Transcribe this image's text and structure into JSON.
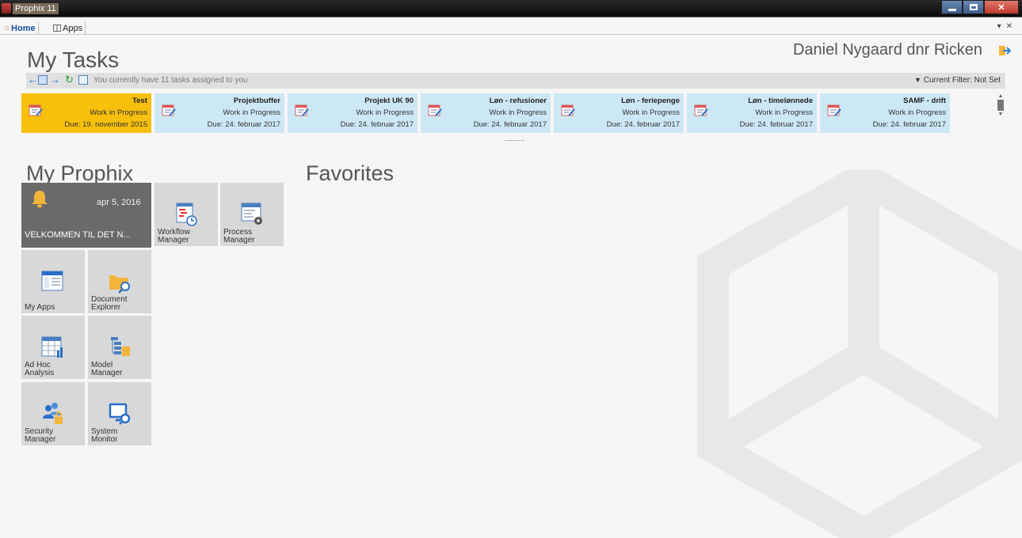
{
  "window": {
    "title": "Prophix 11"
  },
  "tabs": [
    {
      "label": "Home"
    },
    {
      "label": "Apps"
    }
  ],
  "header": {
    "title": "My Tasks",
    "user": "Daniel Nygaard dnr Ricken"
  },
  "tasks_toolbar": {
    "summary": "You currently have 11 tasks assigned to you",
    "filter": "Current Filter: Not Set"
  },
  "tasks": [
    {
      "name": "Test",
      "status": "Work in Progress",
      "due": "Due: 19. november 2015"
    },
    {
      "name": "Projektbuffer",
      "status": "Work in Progress",
      "due": "Due: 24. februar 2017"
    },
    {
      "name": "Projekt UK 90",
      "status": "Work in Progress",
      "due": "Due: 24. februar 2017"
    },
    {
      "name": "Løn - refusioner",
      "status": "Work in Progress",
      "due": "Due: 24. februar 2017"
    },
    {
      "name": "Løn - feriepenge",
      "status": "Work in Progress",
      "due": "Due: 24. februar 2017"
    },
    {
      "name": "Løn - timelønnede",
      "status": "Work in Progress",
      "due": "Due: 24. februar 2017"
    },
    {
      "name": "SAMF - drift",
      "status": "Work in Progress",
      "due": "Due: 24. februar 2017"
    }
  ],
  "pager_dots": "..........",
  "my_prophix": {
    "title": "My Prophix",
    "notice": {
      "date": "apr 5, 2016",
      "message": "VELKOMMEN TIL DET N..."
    },
    "tiles": [
      {
        "label_1": "Workflow",
        "label_2": "Manager",
        "icon": "workflow-icon"
      },
      {
        "label_1": "Process",
        "label_2": "Manager",
        "icon": "process-gear-icon"
      },
      {
        "label_1": "My Apps",
        "label_2": "",
        "icon": "apps-window-icon"
      },
      {
        "label_1": "Document",
        "label_2": "Explorer",
        "icon": "folder-search-icon"
      },
      {
        "label_1": "Ad Hoc",
        "label_2": "Analysis",
        "icon": "table-chart-icon"
      },
      {
        "label_1": "Model",
        "label_2": "Manager",
        "icon": "model-tree-icon"
      },
      {
        "label_1": "Security",
        "label_2": "Manager",
        "icon": "users-lock-icon"
      },
      {
        "label_1": "System",
        "label_2": "Monitor",
        "icon": "monitor-search-icon"
      }
    ]
  },
  "favorites": {
    "title": "Favorites"
  }
}
